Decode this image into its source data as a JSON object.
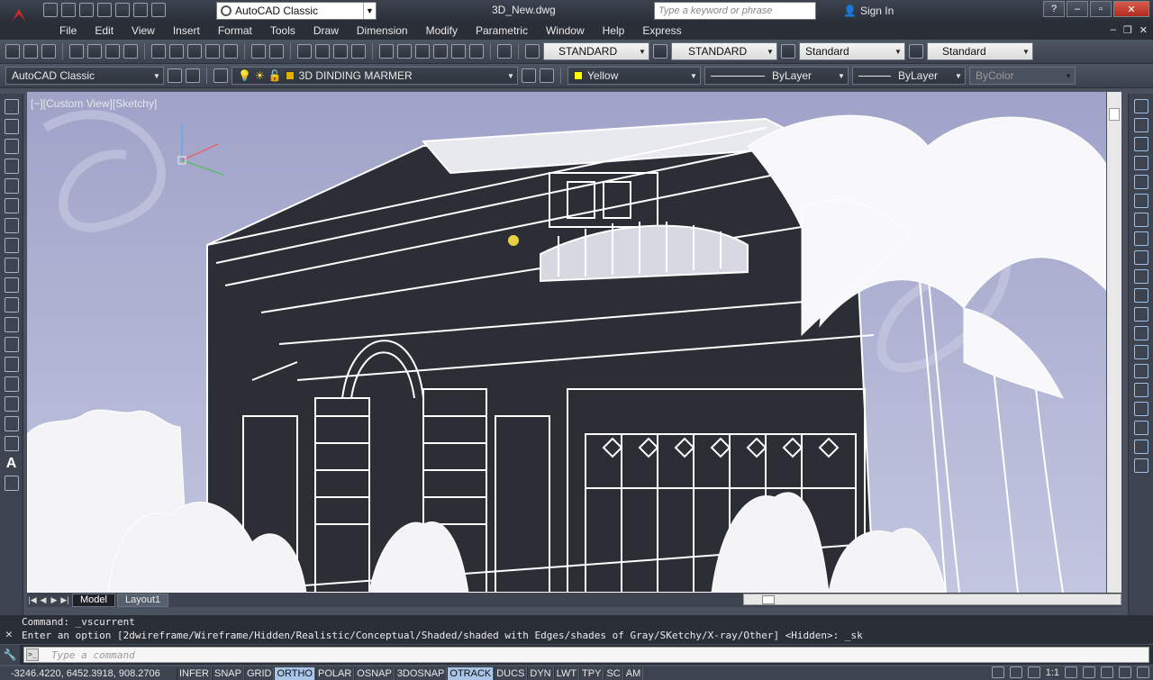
{
  "titlebar": {
    "workspace": "AutoCAD Classic",
    "document_title": "3D_New.dwg",
    "search_placeholder": "Type a keyword or phrase",
    "sign_in": "Sign In"
  },
  "menu": {
    "items": [
      "File",
      "Edit",
      "View",
      "Insert",
      "Format",
      "Tools",
      "Draw",
      "Dimension",
      "Modify",
      "Parametric",
      "Window",
      "Help",
      "Express"
    ]
  },
  "styles": {
    "text_style": "STANDARD",
    "dim_style": "STANDARD",
    "table_style": "Standard",
    "multileader_style": "Standard"
  },
  "toolbar2": {
    "workspace": "AutoCAD Classic",
    "layer": "3D DINDING MARMER",
    "color": "Yellow",
    "linetype": "ByLayer",
    "lineweight": "ByLayer",
    "plotstyle": "ByColor"
  },
  "viewport": {
    "label": "[−][Custom View][Sketchy]"
  },
  "tabs": [
    "Model",
    "Layout1"
  ],
  "command": {
    "history_1": "Command: _vscurrent",
    "history_2": "Enter an option [2dwireframe/Wireframe/Hidden/Realistic/Conceptual/Shaded/shaded with Edges/shades of Gray/SKetchy/X-ray/Other] <Hidden>: _sk",
    "placeholder": "Type a command"
  },
  "status": {
    "coordinates": "-3246.4220, 6452.3918, 908.2706",
    "modes": [
      {
        "label": "INFER",
        "on": false
      },
      {
        "label": "SNAP",
        "on": false
      },
      {
        "label": "GRID",
        "on": false
      },
      {
        "label": "ORTHO",
        "on": true
      },
      {
        "label": "POLAR",
        "on": false
      },
      {
        "label": "OSNAP",
        "on": false
      },
      {
        "label": "3DOSNAP",
        "on": false
      },
      {
        "label": "OTRACK",
        "on": true
      },
      {
        "label": "DUCS",
        "on": false
      },
      {
        "label": "DYN",
        "on": false
      },
      {
        "label": "LWT",
        "on": false
      },
      {
        "label": "TPY",
        "on": false
      },
      {
        "label": "SC",
        "on": false
      },
      {
        "label": "AM",
        "on": false
      }
    ],
    "annotation_scale": "1:1"
  }
}
